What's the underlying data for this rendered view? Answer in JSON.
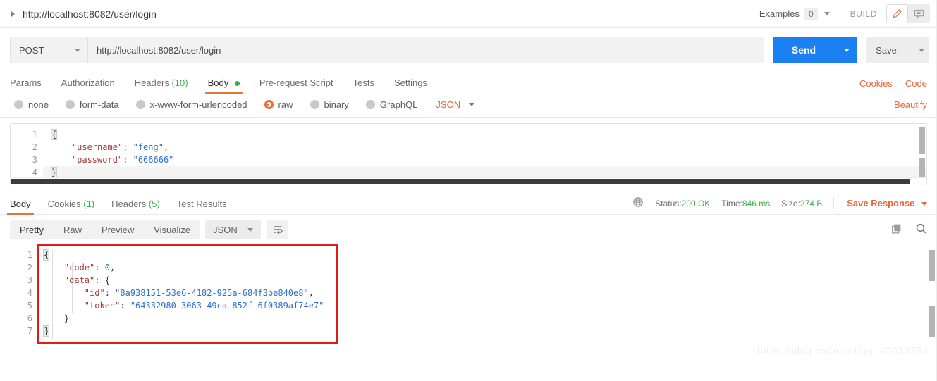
{
  "window": {
    "tab_title": "http://localhost:8082/user/login",
    "examples_label": "Examples",
    "examples_count": "0",
    "build_label": "BUILD",
    "edit_icon": "pencil-icon",
    "comment_icon": "comment-icon"
  },
  "request": {
    "method": "POST",
    "url": "http://localhost:8082/user/login",
    "send_label": "Send",
    "save_label": "Save",
    "tabs": [
      {
        "label": "Params",
        "count": "",
        "dot": false,
        "active": false
      },
      {
        "label": "Authorization",
        "count": "",
        "dot": false,
        "active": false
      },
      {
        "label": "Headers",
        "count": "(10)",
        "dot": false,
        "active": false
      },
      {
        "label": "Body",
        "count": "",
        "dot": true,
        "active": true
      },
      {
        "label": "Pre-request Script",
        "count": "",
        "dot": false,
        "active": false
      },
      {
        "label": "Tests",
        "count": "",
        "dot": false,
        "active": false
      },
      {
        "label": "Settings",
        "count": "",
        "dot": false,
        "active": false
      }
    ],
    "links": {
      "cookies": "Cookies",
      "code": "Code"
    },
    "body_types": [
      {
        "label": "none",
        "checked": false
      },
      {
        "label": "form-data",
        "checked": false
      },
      {
        "label": "x-www-form-urlencoded",
        "checked": false
      },
      {
        "label": "raw",
        "checked": true
      },
      {
        "label": "binary",
        "checked": false
      },
      {
        "label": "GraphQL",
        "checked": false
      }
    ],
    "format_select": "JSON",
    "beautify_label": "Beautify",
    "body_lines": [
      "1",
      "2",
      "3",
      "4"
    ],
    "body_code": {
      "line1": "{",
      "line2_key": "\"username\"",
      "line2_val": "\"feng\"",
      "line3_key": "\"password\"",
      "line3_val": "\"666666\"",
      "line4": "}"
    }
  },
  "response": {
    "tabs": [
      {
        "label": "Body",
        "count": "",
        "active": true
      },
      {
        "label": "Cookies",
        "count": "(1)",
        "active": false
      },
      {
        "label": "Headers",
        "count": "(5)",
        "active": false
      },
      {
        "label": "Test Results",
        "count": "",
        "active": false
      }
    ],
    "globe_icon": "globe-icon",
    "status_label": "Status:",
    "status_value": "200 OK",
    "time_label": "Time:",
    "time_value": "846 ms",
    "size_label": "Size:",
    "size_value": "274 B",
    "save_response": "Save Response",
    "view_modes": [
      {
        "label": "Pretty",
        "active": true
      },
      {
        "label": "Raw",
        "active": false
      },
      {
        "label": "Preview",
        "active": false
      },
      {
        "label": "Visualize",
        "active": false
      }
    ],
    "format_select": "JSON",
    "wrap_icon": "word-wrap-icon",
    "copy_icon": "copy-icon",
    "search_icon": "search-icon",
    "body_lines": [
      "1",
      "2",
      "3",
      "4",
      "5",
      "6",
      "7"
    ],
    "body_code": {
      "line1": "{",
      "line2_key": "\"code\"",
      "line2_val": "0",
      "line3_key": "\"data\"",
      "line3_open": "{",
      "line4_key": "\"id\"",
      "line4_val": "\"8a938151-53e6-4182-925a-684f3be840e8\"",
      "line5_key": "\"token\"",
      "line5_val": "\"64332980-3063-49ca-852f-6f0389af74e7\"",
      "line6": "}",
      "line7": "}"
    },
    "highlight_box_color": "#e01b1b"
  },
  "watermark": "https://blog.csdn.net/qq_40036754",
  "colors": {
    "accent_orange": "#e8673a",
    "send_blue": "#1b81f2",
    "green": "#3caf50",
    "json_key": "#a13a3a",
    "json_value": "#2f6fd0"
  }
}
